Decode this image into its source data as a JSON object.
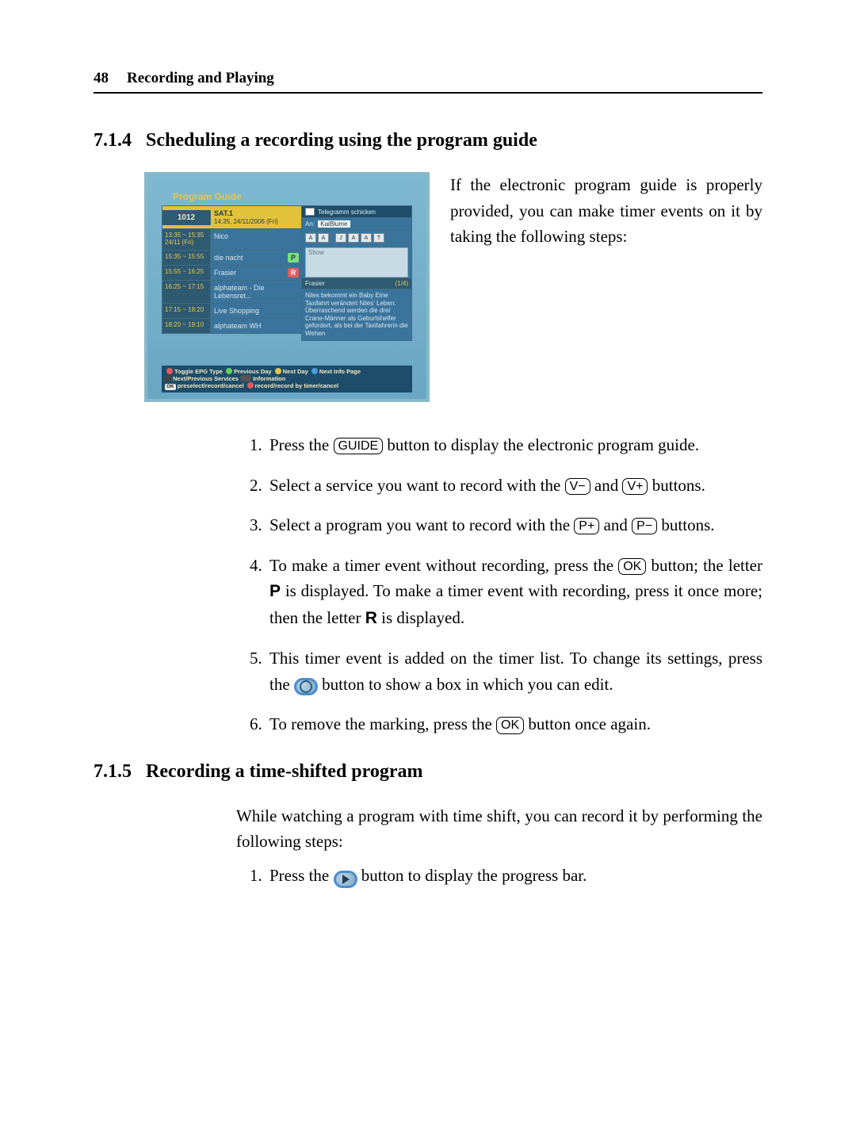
{
  "page_header": {
    "number": "48",
    "title": "Recording and Playing"
  },
  "section_714": {
    "number": "7.1.4",
    "title": "Scheduling a recording using the program guide",
    "intro": "If the electronic program guide is properly provided, you can make timer events on it by taking the following steps:"
  },
  "guide": {
    "title": "Program Guide",
    "channel": {
      "num": "1012",
      "name": "SAT.1",
      "datetime": "14:35, 24/11/2006 (Fri)"
    },
    "rows": [
      {
        "time": "13:35 ~ 15:35\n24/11 (Fri)",
        "prog": "Nico",
        "flag": ""
      },
      {
        "time": "15:35 ~ 15:55",
        "prog": "die nacht",
        "flag": "P"
      },
      {
        "time": "15:55 ~ 16:25",
        "prog": "Frasier",
        "flag": "R"
      },
      {
        "time": "16:25 ~ 17:15",
        "prog": "alphateam - Die Lebensret...",
        "flag": ""
      },
      {
        "time": "17:15 ~ 18:20",
        "prog": "Live Shopping",
        "flag": ""
      },
      {
        "time": "18:20 ~ 19:10",
        "prog": "alphateam WH",
        "flag": ""
      }
    ],
    "side": {
      "title": "Telegramm schicken",
      "an_label": "An:",
      "an_value": "KaiBlume",
      "show": "Show",
      "frasier": "Frasier",
      "page": "(1/4)",
      "desc": "Niles bekommt ein Baby\nEine Taxifahrt verändert Niles' Leben: Überraschend werden die drei Crane-Männer als Geburtshelfer gefordert, als bei der Taxifahrerin die Wehen"
    },
    "footer": {
      "l1a": "Toggle EPG Type",
      "l1b": "Previous Day",
      "l1c": "Next Day",
      "l1d": "Next Info Page",
      "l2a": "Next/Previous Services",
      "l2b": "Information",
      "l3a": "preselect/record/cancel",
      "l3b": "record/record by timer/cancel"
    }
  },
  "steps": {
    "s1a": "Press the ",
    "s1_key": "GUIDE",
    "s1b": " button to display the electronic program guide.",
    "s2a": "Select a service you want to record with the ",
    "s2_vminus": "V−",
    "s2_mid": " and ",
    "s2_vplus": "V+",
    "s2b": " buttons.",
    "s3a": "Select a program you want to record with the ",
    "s3_pplus": "P+",
    "s3_mid": " and ",
    "s3_pminus": "P−",
    "s3b": " buttons.",
    "s4a": "To make a timer event without recording, press the ",
    "s4_ok": "OK",
    "s4b": " button; the letter ",
    "s4_P": "P",
    "s4c": " is displayed. To make a timer event with recording, press it once more; then the letter ",
    "s4_R": "R",
    "s4d": " is displayed.",
    "s5a": "This timer event is added on the timer list. To change its settings, press the ",
    "s5b": " button to show a box in which you can edit.",
    "s6a": "To remove the marking, press the ",
    "s6_ok": "OK",
    "s6b": " button once again."
  },
  "section_715": {
    "number": "7.1.5",
    "title": "Recording a time-shifted program",
    "intro": "While watching a program with time shift, you can record it by performing the following steps:",
    "s1a": "Press the ",
    "s1b": " button to display the progress bar."
  }
}
